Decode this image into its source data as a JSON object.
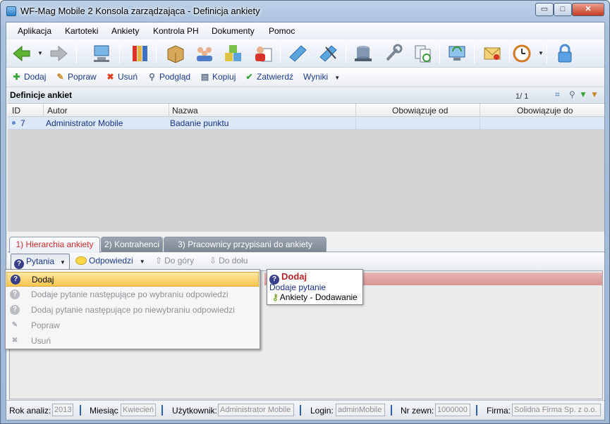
{
  "window": {
    "title": "WF-Mag Mobile 2 Konsola zarządzająca - Definicja ankiety",
    "min": "▭",
    "max": "□",
    "close": "✕"
  },
  "menu": [
    "Aplikacja",
    "Kartoteki",
    "Ankiety",
    "Kontrola PH",
    "Dokumenty",
    "Pomoc"
  ],
  "toolbar_icons": [
    "back-arrow-icon",
    "forward-arrow-icon",
    "computer-icon",
    "books-icon",
    "box-icon",
    "people-icon",
    "cubes-icon",
    "user-document-icon",
    "book-icon",
    "book-pen-icon",
    "database-icon",
    "wrench-icon",
    "sync-icon",
    "monitor-sync-icon",
    "mail-icon",
    "clock-icon",
    "lock-icon"
  ],
  "actions": {
    "dodaj": "Dodaj",
    "popraw": "Popraw",
    "usun": "Usuń",
    "podglad": "Podgląd",
    "kopiuj": "Kopiuj",
    "zatwierdz": "Zatwierdź",
    "wyniki": "Wyniki"
  },
  "section": {
    "title": "Definicje ankiet",
    "pager": "1/ 1"
  },
  "grid": {
    "columns": [
      "ID",
      "Autor",
      "Nazwa",
      "Obowiązuje od",
      "Obowiązuje do"
    ],
    "rows": [
      {
        "id": "7",
        "autor": "Administrator Mobile",
        "nazwa": "Badanie punktu",
        "od": "",
        "do": ""
      }
    ]
  },
  "tabs": [
    "1) Hierarchia ankiety",
    "2) Kontrahenci",
    "3) Pracownicy przypisani do ankiety"
  ],
  "subbar": {
    "pytania": "Pytania",
    "odpowiedzi": "Odpowiedzi",
    "do_gory": "Do góry",
    "do_dolu": "Do dołu"
  },
  "dropdown": [
    {
      "label": "Dodaj",
      "enabled": true
    },
    {
      "label": "Dodaje pytanie następujące po wybraniu odpowiedzi",
      "enabled": false
    },
    {
      "label": "Dodaj pytanie następujące po niewybraniu odpowiedzi",
      "enabled": false
    },
    {
      "label": "Popraw",
      "enabled": false
    },
    {
      "label": "Usuń",
      "enabled": false
    }
  ],
  "tooltip": {
    "title": "Dodaj",
    "description": "Dodaje pytanie",
    "permission": "Ankiety - Dodawanie"
  },
  "status": {
    "rok_label": "Rok analiz:",
    "rok": "2013",
    "miesiac_label": "Miesiąc",
    "miesiac": "Kwiecień",
    "uzytkownik_label": "Użytkownik:",
    "uzytkownik": "Administrator Mobile",
    "login_label": "Login:",
    "login": "adminMobile",
    "nrzewn_label": "Nr zewn:",
    "nrzewn": "1000000",
    "firma_label": "Firma:",
    "firma": "Solidna Firma Sp. z o.o."
  }
}
